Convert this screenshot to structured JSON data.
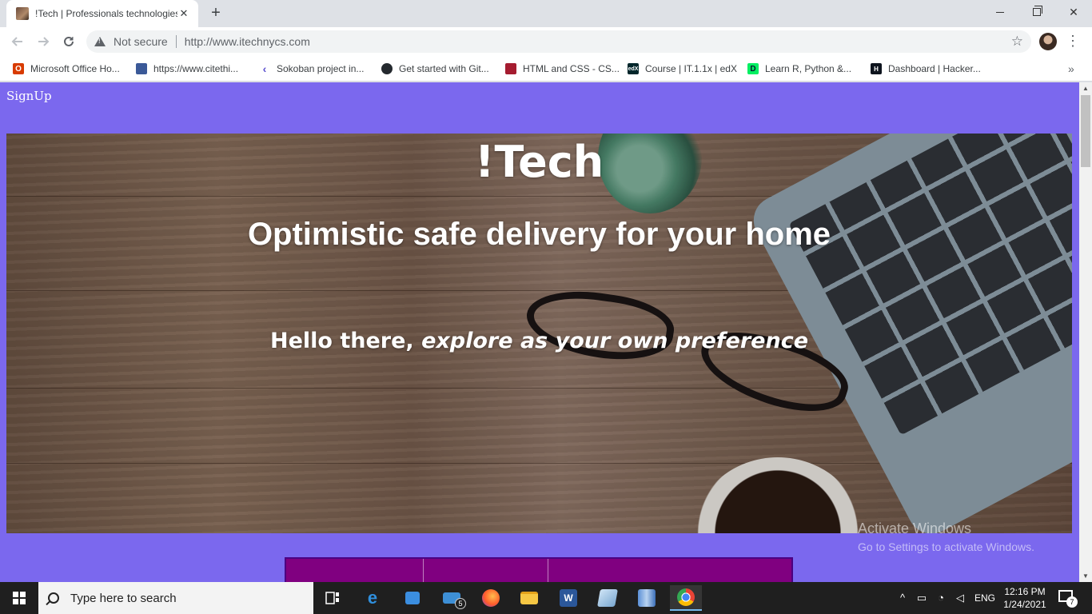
{
  "browser": {
    "tab_title": "!Tech | Professionals technologies",
    "tab_close": "✕",
    "new_tab": "+",
    "security_label": "Not secure",
    "url": "http://www.itechnycs.com",
    "window_close": "✕"
  },
  "bookmarks": [
    {
      "label": "Microsoft Office Ho...",
      "icon": "office-icon",
      "color": "#d83b01"
    },
    {
      "label": "https://www.citethi...",
      "icon": "citethis-icon",
      "color": "#3b5998"
    },
    {
      "label": "Sokoban project in...",
      "icon": "sokoban-icon",
      "color": "#5a4fcf"
    },
    {
      "label": "Get started with Git...",
      "icon": "github-icon",
      "color": "#24292e"
    },
    {
      "label": "HTML and CSS - CS...",
      "icon": "harvard-icon",
      "color": "#a51c30"
    },
    {
      "label": "Course | IT.1.1x | edX",
      "icon": "edx-icon",
      "color": "#02262b"
    },
    {
      "label": "Learn R, Python &...",
      "icon": "datacamp-icon",
      "color": "#03ef62"
    },
    {
      "label": "Dashboard | Hacker...",
      "icon": "hackerrank-icon",
      "color": "#0e141e"
    }
  ],
  "page": {
    "signup": "SignUp",
    "title": "!Tech",
    "subtitle": "Optimistic safe delivery for your home",
    "greeting_plain": "Hello there, ",
    "greeting_italic": "explore as your own preference",
    "colors": {
      "background": "#7b68ee",
      "table": "#800080"
    }
  },
  "watermark": {
    "title": "Activate Windows",
    "subtitle": "Go to Settings to activate Windows."
  },
  "taskbar": {
    "search_placeholder": "Type here to search",
    "mail_badge": "5",
    "language": "ENG",
    "time": "12:16 PM",
    "date": "1/24/2021",
    "notification_count": "7"
  }
}
